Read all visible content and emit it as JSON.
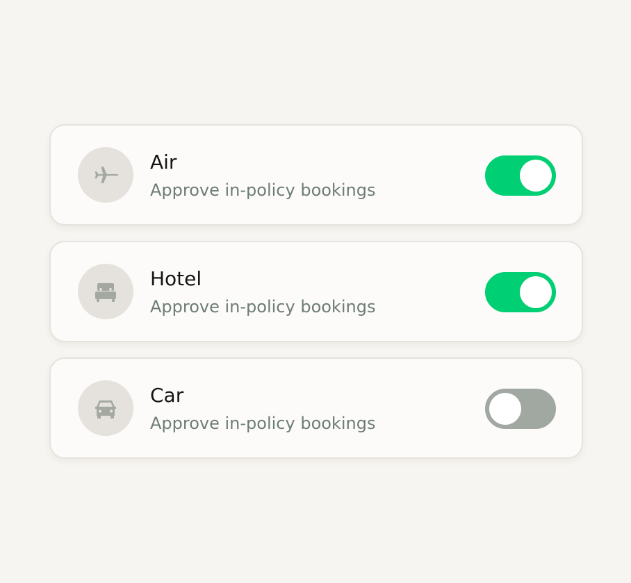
{
  "colors": {
    "background": "#f7f5f1",
    "card": "#fcfbfa",
    "toggle_on": "#00cf73",
    "toggle_off": "#a1a8a1",
    "icon": "#a3a9a1",
    "subtitle": "#6e7d74"
  },
  "settings": [
    {
      "icon": "airplane-icon",
      "title": "Air",
      "subtitle": "Approve in-policy bookings",
      "enabled": true
    },
    {
      "icon": "bed-icon",
      "title": "Hotel",
      "subtitle": "Approve in-policy bookings",
      "enabled": true
    },
    {
      "icon": "car-icon",
      "title": "Car",
      "subtitle": "Approve in-policy bookings",
      "enabled": false
    }
  ]
}
